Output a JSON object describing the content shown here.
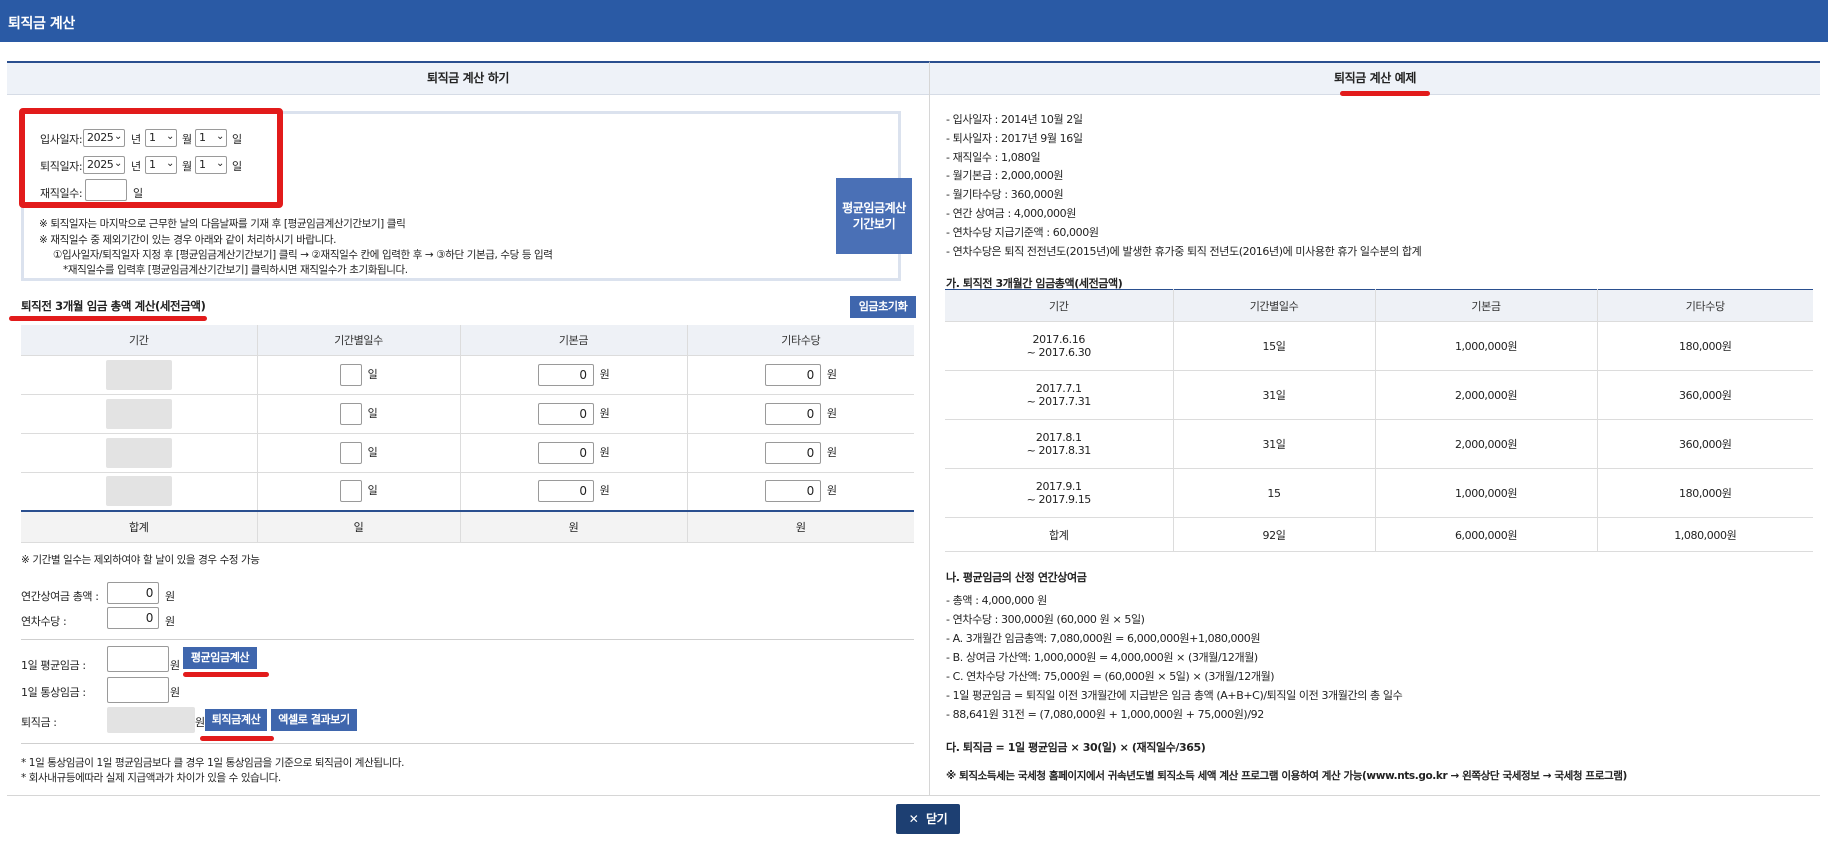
{
  "window": {
    "title": "퇴직금 계산"
  },
  "left": {
    "title": "퇴직금 계산 하기",
    "start_date": {
      "label": "입사일자:",
      "year": "2025",
      "year_unit": "년",
      "month": "1",
      "month_unit": "월",
      "day": "1",
      "day_unit": "일"
    },
    "end_date": {
      "label": "퇴직일자:",
      "year": "2025",
      "year_unit": "년",
      "month": "1",
      "month_unit": "월",
      "day": "1",
      "day_unit": "일"
    },
    "work_days": {
      "label": "재직일수:",
      "value": "",
      "unit": "일"
    },
    "period_button": "평균임금계산 기간보기",
    "notes": [
      "※ 퇴직일자는 마지막으로 근무한 날의 다음날짜를 기재 후 [평균임금계산기간보기] 클릭",
      "※ 재직일수 중 제외기간이 있는 경우 아래와 같이 처리하시기 바랍니다.",
      "①입사일자/퇴직일자 지정 후 [평균임금계산기간보기] 클릭 → ②재직일수 칸에 입력한 후 → ③하단 기본급, 수당 등 입력",
      "*재직일수를 입력후 [평균임금계산기간보기] 클릭하시면 재직일수가 초기화됩니다."
    ],
    "section_title": "퇴직전 3개월 임금 총액 계산(세전금액)",
    "reset_button": "임금초기화",
    "table": {
      "headers": [
        "기간",
        "기간별일수",
        "기본금",
        "기타수당"
      ],
      "rows": [
        {
          "days_unit": "일",
          "base": "0",
          "base_unit": "원",
          "other": "0",
          "other_unit": "원"
        },
        {
          "days_unit": "일",
          "base": "0",
          "base_unit": "원",
          "other": "0",
          "other_unit": "원"
        },
        {
          "days_unit": "일",
          "base": "0",
          "base_unit": "원",
          "other": "0",
          "other_unit": "원"
        },
        {
          "days_unit": "일",
          "base": "0",
          "base_unit": "원",
          "other": "0",
          "other_unit": "원"
        }
      ],
      "total": {
        "label": "합계",
        "days": "일",
        "base": "원",
        "other": "원"
      }
    },
    "table_note": "※ 기간별 일수는 제외하여야 할 날이 있을 경우 수정 가능",
    "annual_bonus": {
      "label": "연간상여금 총액 :",
      "value": "0",
      "unit": "원"
    },
    "annual_leave": {
      "label": "연차수당 :",
      "value": "0",
      "unit": "원"
    },
    "daily_avg": {
      "label": "1일 평균임금 :",
      "value": "",
      "unit": "원",
      "button": "평균임금계산"
    },
    "daily_ordinary": {
      "label": "1일 통상임금 :",
      "value": "",
      "unit": "원"
    },
    "severance": {
      "label": "퇴직금 :",
      "unit": "원",
      "calc_button": "퇴직금계산",
      "excel_button": "엑셀로 결과보기"
    },
    "footnotes": [
      "* 1일 통상임금이 1일 평균임금보다 클 경우 1일 통상임금을 기준으로 퇴직금이 계산됩니다.",
      "* 회사내규등에따라 실제 지급액과가 차이가 있을 수 있습니다."
    ]
  },
  "right": {
    "title": "퇴직금 계산 예제",
    "info": [
      "- 입사일자 : 2014년 10월 2일",
      "- 퇴사일자 : 2017년 9월 16일",
      "- 재직일수 : 1,080일",
      "- 월기본급 : 2,000,000원",
      "- 월기타수당 : 360,000원",
      "- 연간 상여금 : 4,000,000원",
      "- 연차수당 지급기준액 : 60,000원",
      "- 연차수당은 퇴직 전전년도(2015년)에 발생한 휴가중 퇴직 전년도(2016년)에 미사용한 휴가 일수분의 합계"
    ],
    "section_a": "가. 퇴직전 3개월간 임금총액(세전금액)",
    "table": {
      "headers": [
        "기간",
        "기간별일수",
        "기본금",
        "기타수당"
      ],
      "rows": [
        {
          "from": "2017.6.16",
          "to": "~ 2017.6.30",
          "days": "15일",
          "base": "1,000,000원",
          "other": "180,000원"
        },
        {
          "from": "2017.7.1",
          "to": "~ 2017.7.31",
          "days": "31일",
          "base": "2,000,000원",
          "other": "360,000원"
        },
        {
          "from": "2017.8.1",
          "to": "~ 2017.8.31",
          "days": "31일",
          "base": "2,000,000원",
          "other": "360,000원"
        },
        {
          "from": "2017.9.1",
          "to": "~ 2017.9.15",
          "days": "15",
          "base": "1,000,000원",
          "other": "180,000원"
        }
      ],
      "total": {
        "label": "합계",
        "days": "92일",
        "base": "6,000,000원",
        "other": "1,080,000원"
      }
    },
    "section_b": "나. 평균임금의 산정 연간상여금",
    "section_b_lines": [
      "- 총액 : 4,000,000 원",
      "- 연차수당 : 300,000원 (60,000 원 × 5일)",
      "- A. 3개월간 임금총액: 7,080,000원 = 6,000,000원+1,080,000원",
      "- B. 상여금 가산액: 1,000,000원 = 4,000,000원 × (3개월/12개월)",
      "- C. 연차수당 가산액: 75,000원 = (60,000원 × 5일) × (3개월/12개월)",
      "- 1일 평균임금 = 퇴직일 이전 3개월간에 지급받은 임금 총액 (A+B+C)/퇴직일 이전 3개월간의 총 일수",
      "- 88,641원 31전 = (7,080,000원 + 1,000,000원 + 75,000원)/92"
    ],
    "section_c": "다. 퇴직금 = 1일 평균임금 × 30(일) × (재직일수/365)",
    "tax_note": "※ 퇴직소득세는 국세청 홈페이지에서 귀속년도별 퇴직소득 세액 계산 프로그램 이용하여 계산 가능(www.nts.go.kr → 왼쪽상단 국세정보 → 국세청 프로그램)"
  },
  "close_button": "닫기",
  "colors": {
    "header_bg": "#2a5aa5",
    "button_blue": "#3f66ad",
    "close_bg": "#1d3f72",
    "highlight_red": "#e21b1b"
  }
}
